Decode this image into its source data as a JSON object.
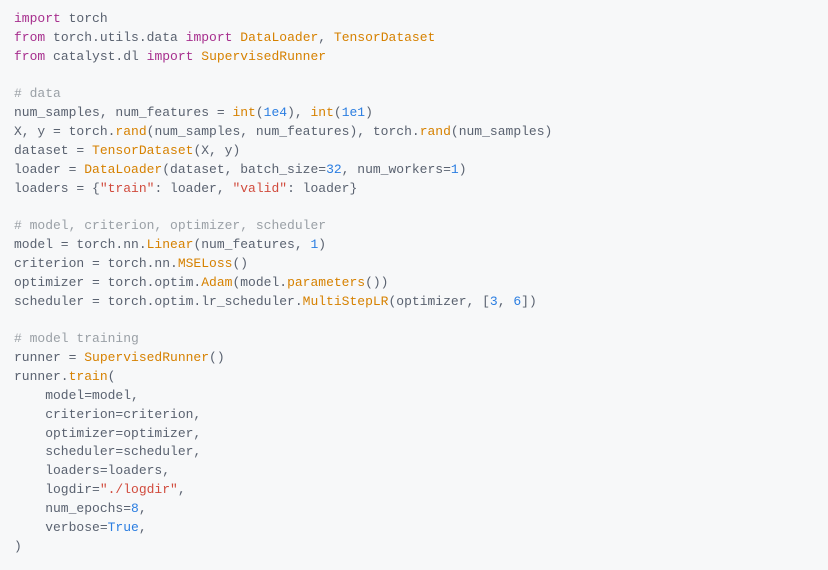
{
  "code": {
    "l01a": "import",
    "l01b": " torch",
    "l02a": "from",
    "l02b": " torch.utils.data ",
    "l02c": "import",
    "l02d": " ",
    "l02e": "DataLoader",
    "l02f": ", ",
    "l02g": "TensorDataset",
    "l03a": "from",
    "l03b": " catalyst.dl ",
    "l03c": "import",
    "l03d": " ",
    "l03e": "SupervisedRunner",
    "l05": "# data",
    "l06a": "num_samples, num_features = ",
    "l06b": "int",
    "l06c": "(",
    "l06d": "1e4",
    "l06e": "), ",
    "l06f": "int",
    "l06g": "(",
    "l06h": "1e1",
    "l06i": ")",
    "l07a": "X, y = torch.",
    "l07b": "rand",
    "l07c": "(num_samples, num_features), torch.",
    "l07d": "rand",
    "l07e": "(num_samples)",
    "l08a": "dataset = ",
    "l08b": "TensorDataset",
    "l08c": "(X, y)",
    "l09a": "loader = ",
    "l09b": "DataLoader",
    "l09c": "(dataset, batch_size=",
    "l09d": "32",
    "l09e": ", num_workers=",
    "l09f": "1",
    "l09g": ")",
    "l10a": "loaders = {",
    "l10b": "\"train\"",
    "l10c": ": loader, ",
    "l10d": "\"valid\"",
    "l10e": ": loader}",
    "l12": "# model, criterion, optimizer, scheduler",
    "l13a": "model = torch.nn.",
    "l13b": "Linear",
    "l13c": "(num_features, ",
    "l13d": "1",
    "l13e": ")",
    "l14a": "criterion = torch.nn.",
    "l14b": "MSELoss",
    "l14c": "()",
    "l15a": "optimizer = torch.optim.",
    "l15b": "Adam",
    "l15c": "(model.",
    "l15d": "parameters",
    "l15e": "())",
    "l16a": "scheduler = torch.optim.lr_scheduler.",
    "l16b": "MultiStepLR",
    "l16c": "(optimizer, [",
    "l16d": "3",
    "l16e": ", ",
    "l16f": "6",
    "l16g": "])",
    "l18": "# model training",
    "l19a": "runner = ",
    "l19b": "SupervisedRunner",
    "l19c": "()",
    "l20a": "runner.",
    "l20b": "train",
    "l20c": "(",
    "l21": "    model=model,",
    "l22": "    criterion=criterion,",
    "l23": "    optimizer=optimizer,",
    "l24": "    scheduler=scheduler,",
    "l25": "    loaders=loaders,",
    "l26a": "    logdir=",
    "l26b": "\"./logdir\"",
    "l26c": ",",
    "l27a": "    num_epochs=",
    "l27b": "8",
    "l27c": ",",
    "l28a": "    verbose=",
    "l28b": "True",
    "l28c": ",",
    "l29": ")"
  }
}
